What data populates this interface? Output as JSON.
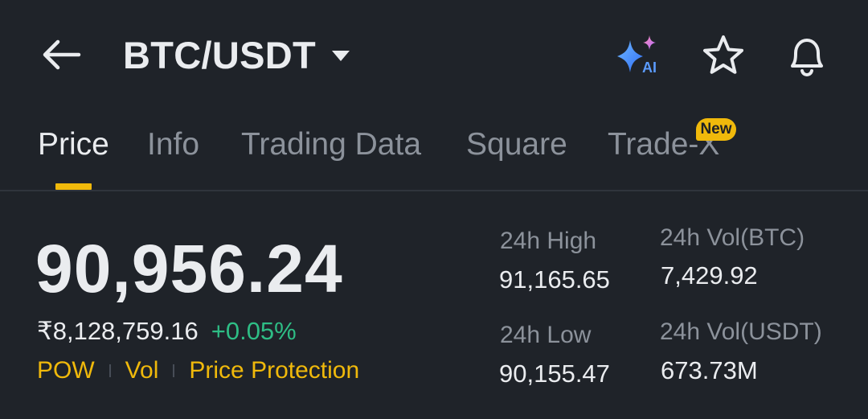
{
  "header": {
    "pair": "BTC/USDT",
    "icons": [
      "back-arrow-icon",
      "caret-down-icon",
      "ai-sparkle-icon",
      "star-icon",
      "bell-icon"
    ],
    "ai_label": "AI"
  },
  "tabs": [
    {
      "label": "Price",
      "active": true
    },
    {
      "label": "Info",
      "active": false
    },
    {
      "label": "Trading Data",
      "active": false
    },
    {
      "label": "Square",
      "active": false
    },
    {
      "label": "Trade-X",
      "active": false,
      "badge": "New"
    }
  ],
  "ticker": {
    "last_price": "90,956.24",
    "fiat_price": "₹8,128,759.16",
    "change_pct": "+0.05%",
    "tags": [
      "POW",
      "Vol",
      "Price Protection"
    ]
  },
  "stats": {
    "high_label": "24h High",
    "high_value": "91,165.65",
    "low_label": "24h Low",
    "low_value": "90,155.47",
    "vol_base_label": "24h Vol(BTC)",
    "vol_base_value": "7,429.92",
    "vol_quote_label": "24h Vol(USDT)",
    "vol_quote_value": "673.73M"
  },
  "colors": {
    "background": "#1f2329",
    "accent": "#f0b90b",
    "positive": "#2ebd85",
    "text_primary": "#eaecef",
    "text_secondary": "#8c929b"
  }
}
